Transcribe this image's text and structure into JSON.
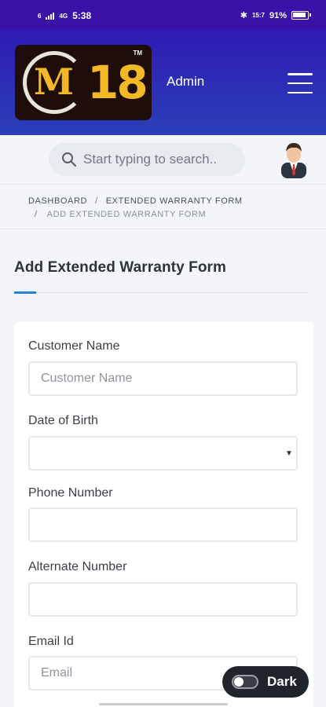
{
  "status_bar": {
    "left_small": "6",
    "network": "4G",
    "time": "5:38",
    "right_small": "15:7",
    "battery": "91%"
  },
  "header": {
    "logo_letter": "M",
    "logo_number": "18",
    "logo_tm": "TM",
    "user_label": "Admin"
  },
  "search": {
    "placeholder": "Start typing to search.."
  },
  "breadcrumb": {
    "items": [
      "DASHBOARD",
      "EXTENDED WARRANTY FORM",
      "ADD EXTENDED WARRANTY FORM"
    ],
    "separator": "/"
  },
  "page": {
    "title": "Add Extended Warranty Form"
  },
  "form": {
    "fields": [
      {
        "label": "Customer Name",
        "placeholder": "Customer Name",
        "value": ""
      },
      {
        "label": "Date of Birth",
        "placeholder": "",
        "value": ""
      },
      {
        "label": "Phone Number",
        "placeholder": "",
        "value": ""
      },
      {
        "label": "Alternate Number",
        "placeholder": "",
        "value": ""
      },
      {
        "label": "Email Id",
        "placeholder": "Email",
        "value": ""
      }
    ]
  },
  "theme_toggle": {
    "label": "Dark",
    "enabled": false
  },
  "colors": {
    "header": "#2f1bb3",
    "accent": "#1b86e8",
    "toggle_bg": "#20242b"
  }
}
